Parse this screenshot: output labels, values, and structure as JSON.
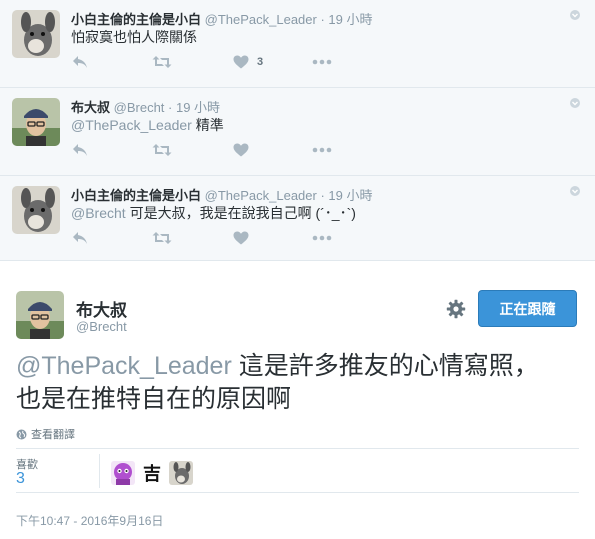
{
  "replies": [
    {
      "name": "小白主倫的主倫是小白",
      "handle": "@ThePack_Leader",
      "time": "· 19 小時",
      "mention": "",
      "text": "怕寂寞也怕人際關係",
      "like_count": "3"
    },
    {
      "name": "布大叔",
      "handle": "@Brecht",
      "time": "· 19 小時",
      "mention": "@ThePack_Leader",
      "text": "精準",
      "like_count": ""
    },
    {
      "name": "小白主倫的主倫是小白",
      "handle": "@ThePack_Leader",
      "time": "· 19 小時",
      "mention": "@Brecht",
      "text": "可是大叔，我是在說我自己啊 (´･_･`)",
      "like_count": ""
    }
  ],
  "main_tweet": {
    "name": "布大叔",
    "handle": "@Brecht",
    "follow_label": "正在跟隨",
    "mention": "@ThePack_Leader",
    "text_line1": " 這是許多推友的心情寫照，",
    "text_line2": "也是在推特自在的原因啊",
    "translate_label": "查看翻譯",
    "likes_label": "喜歡",
    "likes_count": "3",
    "liker_glyph": "吉",
    "timestamp": "下午10:47 - 2016年9月16日"
  },
  "colors": {
    "accent": "#3b94d9",
    "muted": "#8899a6",
    "thread_bg": "#f5f8fa"
  },
  "icons": [
    "reply-icon",
    "retweet-icon",
    "heart-icon",
    "more-dots-icon",
    "gear-icon",
    "globe-icon",
    "caret-icon"
  ]
}
